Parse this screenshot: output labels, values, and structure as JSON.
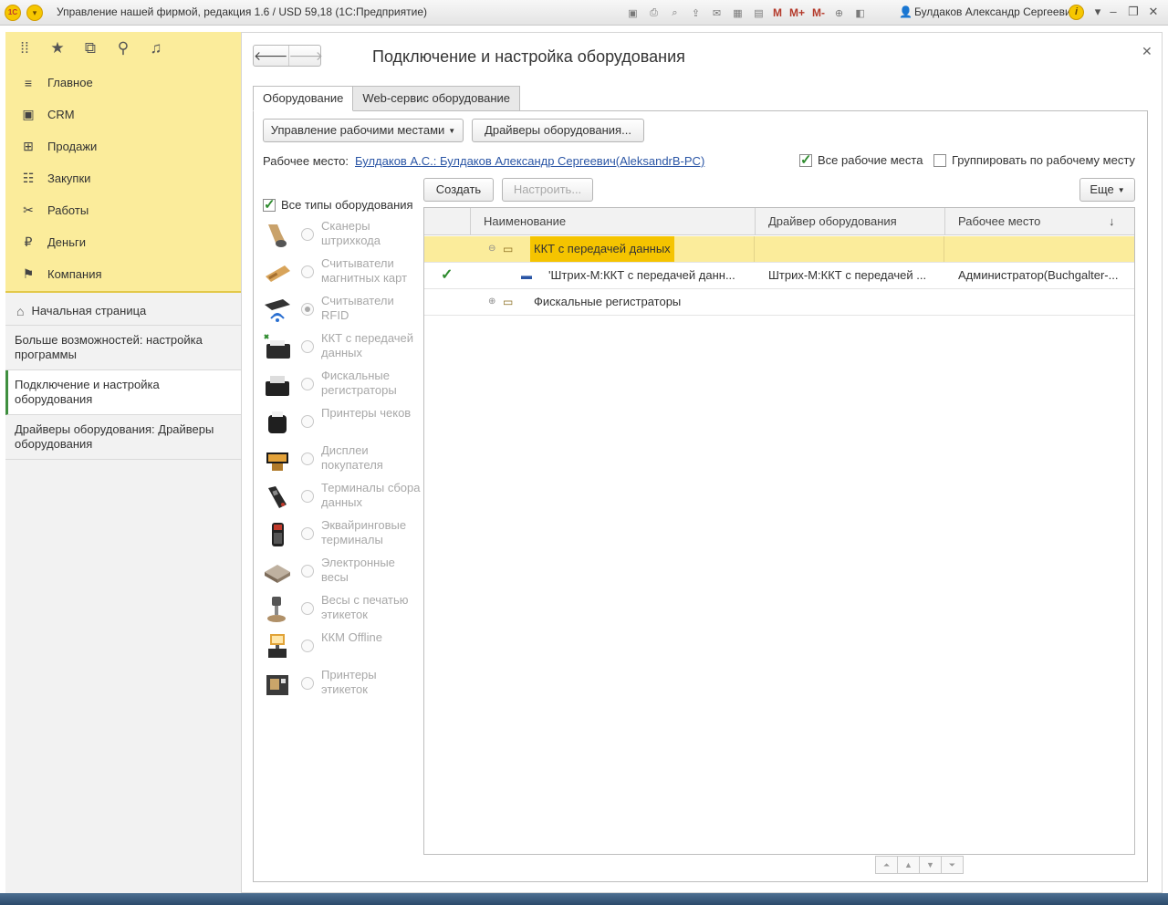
{
  "app": {
    "title": "Управление нашей фирмой, редакция 1.6 / USD 59,18  (1С:Предприятие)",
    "user": "Булдаков Александр Сергеевич",
    "logo": "1С",
    "m_labels": [
      "M",
      "M+",
      "M-"
    ]
  },
  "sidebar": {
    "sections": [
      {
        "label": "Главное",
        "icon": "menu-lines-icon"
      },
      {
        "label": "CRM",
        "icon": "contact-card-icon"
      },
      {
        "label": "Продажи",
        "icon": "cart-icon"
      },
      {
        "label": "Закупки",
        "icon": "list-icon"
      },
      {
        "label": "Работы",
        "icon": "tools-icon"
      },
      {
        "label": "Деньги",
        "icon": "ruble-icon"
      },
      {
        "label": "Компания",
        "icon": "flag-icon"
      }
    ],
    "home": "Начальная страница",
    "links": [
      "Больше возможностей: настройка программы",
      "Подключение и настройка оборудования",
      "Драйверы оборудования: Драйверы оборудования"
    ]
  },
  "page": {
    "title": "Подключение и настройка оборудования",
    "tabs": [
      "Оборудование",
      "Web-сервис оборудование"
    ],
    "buttons": {
      "workplaces": "Управление рабочими местами",
      "drivers": "Драйверы оборудования...",
      "create": "Создать",
      "configure": "Настроить...",
      "more": "Еще"
    },
    "workplace_label": "Рабочее место:",
    "workplace_value": "Булдаков А.С.: Булдаков Александр Сергеевич(AleksandrB-PC)",
    "all_workplaces": "Все рабочие места",
    "group_by_workplace": "Группировать по рабочему месту",
    "all_types": "Все типы оборудования"
  },
  "equipment_types": [
    {
      "label": "Сканеры штрихкода",
      "icon": "barcode-scanner-icon"
    },
    {
      "label": "Считыватели магнитных карт",
      "icon": "card-reader-icon"
    },
    {
      "label": "Считыватели RFID",
      "icon": "rfid-reader-icon"
    },
    {
      "label": "ККТ с передачей данных",
      "icon": "cash-register-icon"
    },
    {
      "label": "Фискальные регистраторы",
      "icon": "fiscal-printer-icon"
    },
    {
      "label": "Принтеры чеков",
      "icon": "receipt-printer-icon"
    },
    {
      "label": "Дисплеи покупателя",
      "icon": "customer-display-icon"
    },
    {
      "label": "Терминалы сбора данных",
      "icon": "data-terminal-icon"
    },
    {
      "label": "Эквайринговые терминалы",
      "icon": "payment-terminal-icon"
    },
    {
      "label": "Электронные весы",
      "icon": "scale-icon"
    },
    {
      "label": "Весы с печатью этикеток",
      "icon": "label-scale-icon"
    },
    {
      "label": "ККМ Offline",
      "icon": "pos-terminal-icon"
    },
    {
      "label": "Принтеры этикеток",
      "icon": "label-printer-icon"
    }
  ],
  "grid": {
    "columns": [
      "Наименование",
      "Драйвер оборудования",
      "Рабочее место"
    ],
    "rows": [
      {
        "type": "group",
        "name": "ККТ с передачей данных",
        "expanded": true
      },
      {
        "type": "item",
        "name": "'Штрих-М:ККТ с передачей данн...",
        "driver": "Штрих-М:ККТ с передачей ...",
        "workplace": "Администратор(Buchgalter-...",
        "checked": true
      },
      {
        "type": "group",
        "name": "Фискальные регистраторы",
        "expanded": false
      }
    ]
  },
  "colors": {
    "accent_yellow": "#fbec9b",
    "link": "#2a55a5",
    "check_green": "#2e8b2e"
  }
}
